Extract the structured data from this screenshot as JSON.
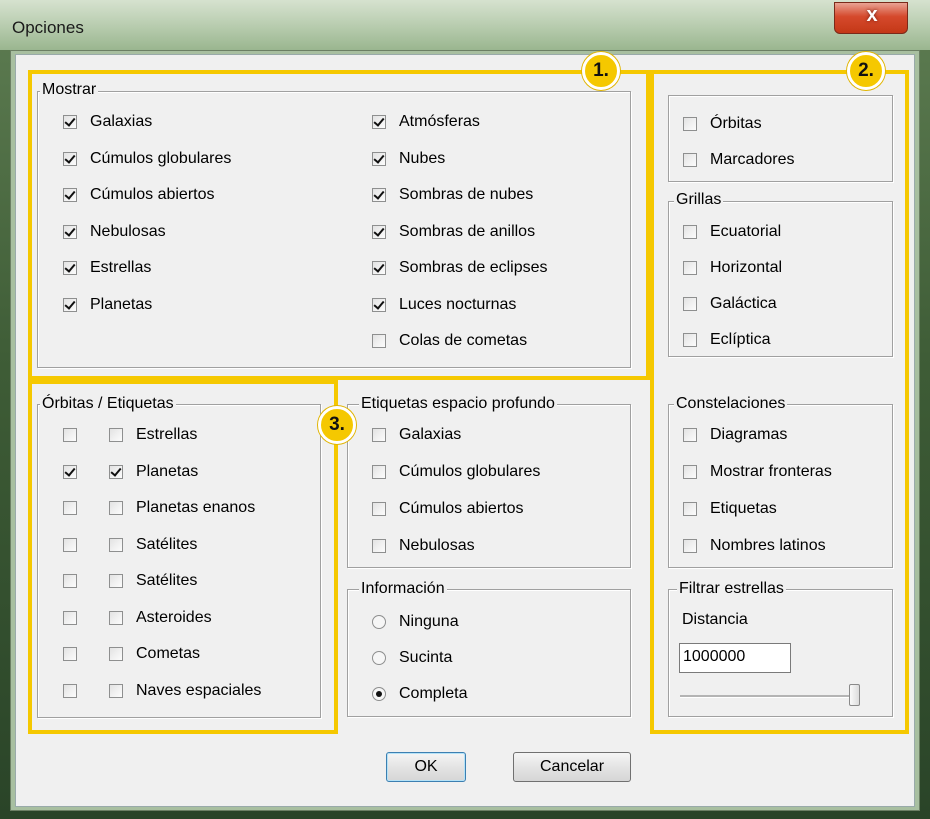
{
  "window": {
    "title": "Opciones",
    "close_glyph": "x"
  },
  "mostrar": {
    "title": "Mostrar",
    "left": [
      {
        "label": "Galaxias",
        "checked": true
      },
      {
        "label": "Cúmulos globulares",
        "checked": true
      },
      {
        "label": "Cúmulos abiertos",
        "checked": true
      },
      {
        "label": "Nebulosas",
        "checked": true
      },
      {
        "label": "Estrellas",
        "checked": true
      },
      {
        "label": "Planetas",
        "checked": true
      }
    ],
    "right": [
      {
        "label": "Atmósferas",
        "checked": true
      },
      {
        "label": "Nubes",
        "checked": true
      },
      {
        "label": "Sombras de nubes",
        "checked": true
      },
      {
        "label": "Sombras de anillos",
        "checked": true
      },
      {
        "label": "Sombras de eclipses",
        "checked": true
      },
      {
        "label": "Luces nocturnas",
        "checked": true
      },
      {
        "label": "Colas de cometas",
        "checked": false
      }
    ]
  },
  "misc": [
    {
      "label": "Órbitas",
      "checked": false
    },
    {
      "label": "Marcadores",
      "checked": false
    }
  ],
  "grillas": {
    "title": "Grillas",
    "items": [
      {
        "label": "Ecuatorial",
        "checked": false
      },
      {
        "label": "Horizontal",
        "checked": false
      },
      {
        "label": "Galáctica",
        "checked": false
      },
      {
        "label": "Eclíptica",
        "checked": false
      }
    ]
  },
  "orbitas_etiquetas": {
    "title": "Órbitas / Etiquetas",
    "items": [
      {
        "label": "Estrellas",
        "orbit": false,
        "label_checked": false
      },
      {
        "label": "Planetas",
        "orbit": true,
        "label_checked": true
      },
      {
        "label": "Planetas enanos",
        "orbit": false,
        "label_checked": false
      },
      {
        "label": "Satélites",
        "orbit": false,
        "label_checked": false
      },
      {
        "label": "Satélites",
        "orbit": false,
        "label_checked": false
      },
      {
        "label": "Asteroides",
        "orbit": false,
        "label_checked": false
      },
      {
        "label": "Cometas",
        "orbit": false,
        "label_checked": false
      },
      {
        "label": "Naves espaciales",
        "orbit": false,
        "label_checked": false
      }
    ]
  },
  "etiquetas_espacio": {
    "title": "Etiquetas espacio profundo",
    "items": [
      {
        "label": "Galaxias",
        "checked": false
      },
      {
        "label": "Cúmulos globulares",
        "checked": false
      },
      {
        "label": "Cúmulos abiertos",
        "checked": false
      },
      {
        "label": "Nebulosas",
        "checked": false
      }
    ]
  },
  "informacion": {
    "title": "Información",
    "items": [
      {
        "label": "Ninguna",
        "selected": false
      },
      {
        "label": "Sucinta",
        "selected": false
      },
      {
        "label": "Completa",
        "selected": true
      }
    ]
  },
  "constelaciones": {
    "title": "Constelaciones",
    "items": [
      {
        "label": "Diagramas",
        "checked": false
      },
      {
        "label": "Mostrar fronteras",
        "checked": false
      },
      {
        "label": "Etiquetas",
        "checked": false
      },
      {
        "label": "Nombres latinos",
        "checked": false
      }
    ]
  },
  "filtrar": {
    "title": "Filtrar estrellas",
    "distance_label": "Distancia",
    "distance_value": "1000000",
    "slider_fraction": 1.0
  },
  "buttons": {
    "ok": "OK",
    "cancel": "Cancelar"
  },
  "badges": [
    "1.",
    "2.",
    "3."
  ],
  "accent_color": "#f5c800"
}
